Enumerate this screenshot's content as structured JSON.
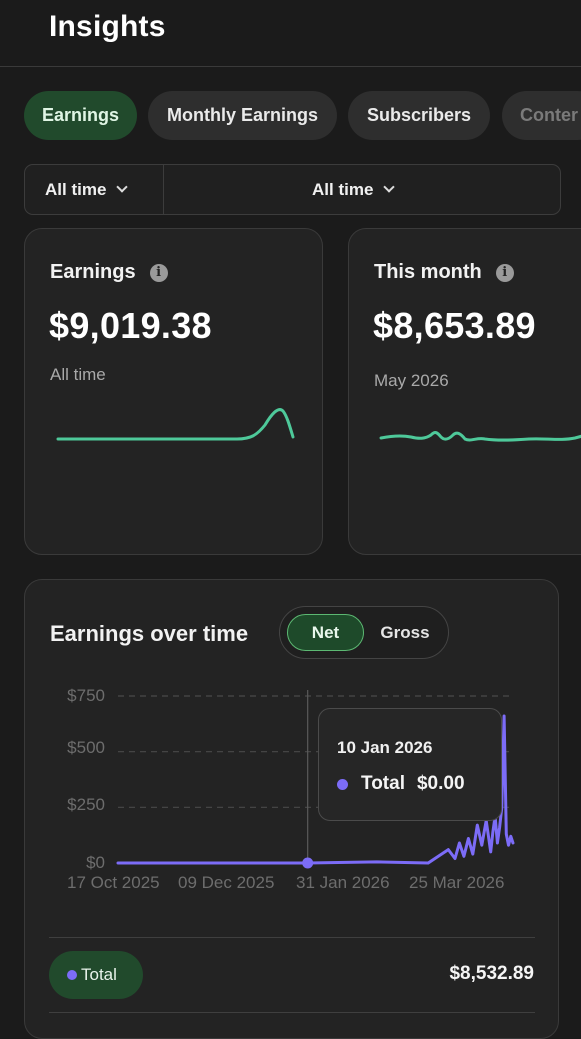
{
  "header": {
    "title": "Insights"
  },
  "tabs": [
    {
      "label": "Earnings",
      "active": true
    },
    {
      "label": "Monthly Earnings",
      "active": false
    },
    {
      "label": "Subscribers",
      "active": false
    },
    {
      "label": "Conter",
      "active": false
    }
  ],
  "filters": {
    "left": "All time",
    "right": "All time"
  },
  "cards": [
    {
      "title": "Earnings",
      "value": "$9,019.38",
      "subtitle": "All time",
      "info_icon": "info-icon"
    },
    {
      "title": "This month",
      "value": "$8,653.89",
      "subtitle": "May 2026",
      "info_icon": "info-icon"
    }
  ],
  "colors": {
    "accent_green": "#4ec99a",
    "series_purple": "#7c6cf7",
    "active_bg": "#214a2c"
  },
  "earnings_over_time": {
    "title": "Earnings over time",
    "toggle": {
      "net": "Net",
      "gross": "Gross",
      "selected": "Net"
    },
    "tooltip": {
      "date": "10 Jan 2026",
      "series": "Total",
      "value": "$0.00"
    },
    "total_label": "Total",
    "total_value": "$8,532.89"
  },
  "chart_data": {
    "type": "line",
    "x_tick_labels": [
      "17 Oct 2025",
      "09 Dec 2025",
      "31 Jan 2026",
      "25 Mar 2026"
    ],
    "y_tick_labels": [
      "$750",
      "$500",
      "$250",
      "$0"
    ],
    "ylim": [
      0,
      750
    ],
    "grid": true,
    "series": [
      {
        "name": "Total",
        "color": "#7c6cf7",
        "x": [
          "2025-10-17",
          "2025-11-20",
          "2025-12-20",
          "2026-01-10",
          "2026-02-10",
          "2026-03-05",
          "2026-03-14",
          "2026-03-17",
          "2026-03-19",
          "2026-03-21",
          "2026-03-23",
          "2026-03-25",
          "2026-03-27",
          "2026-03-29",
          "2026-03-31",
          "2026-04-02",
          "2026-04-03",
          "2026-04-04",
          "2026-04-05",
          "2026-04-06",
          "2026-04-07",
          "2026-04-08",
          "2026-04-09",
          "2026-04-10",
          "2026-04-11",
          "2026-04-12"
        ],
        "values": [
          0,
          0,
          0,
          0,
          5,
          0,
          60,
          20,
          90,
          30,
          110,
          40,
          170,
          80,
          190,
          50,
          140,
          210,
          90,
          160,
          250,
          660,
          130,
          80,
          120,
          90
        ]
      }
    ],
    "highlight": {
      "x": "2026-01-10",
      "value": 0
    }
  }
}
